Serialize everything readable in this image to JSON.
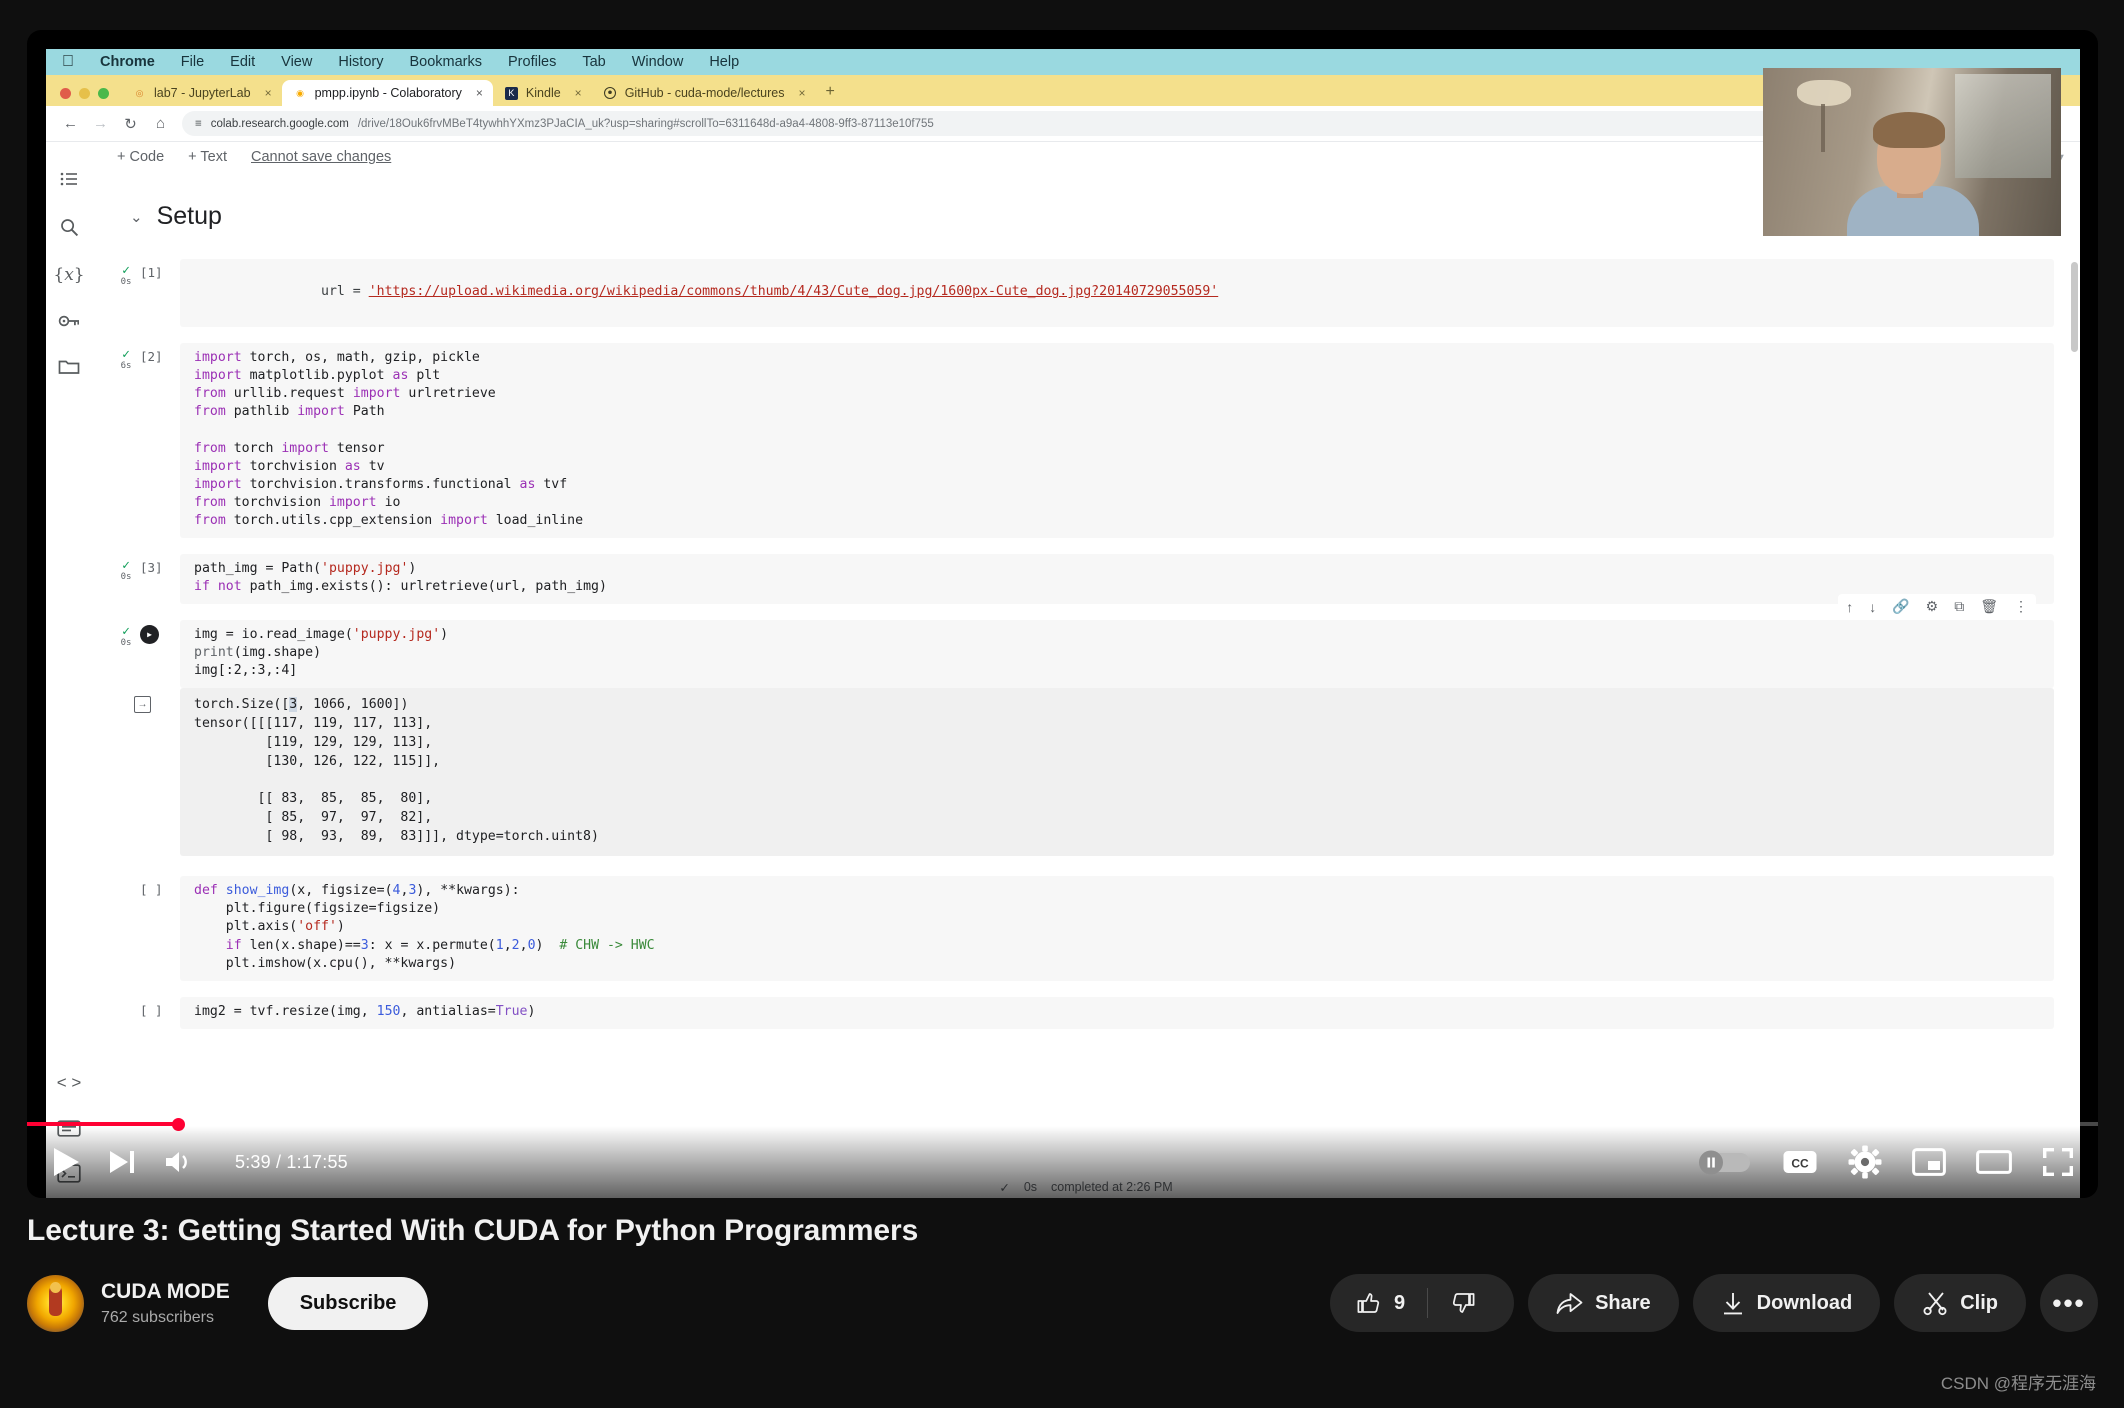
{
  "os_menu": {
    "apple": "apple-logo",
    "items": [
      "Chrome",
      "File",
      "Edit",
      "View",
      "History",
      "Bookmarks",
      "Profiles",
      "Tab",
      "Window",
      "Help"
    ]
  },
  "browser": {
    "tabs": [
      {
        "title": "lab7 - JupyterLab",
        "favicon": "jupyter-icon",
        "active": false
      },
      {
        "title": "pmpp.ipynb - Colaboratory",
        "favicon": "colab-icon",
        "active": true
      },
      {
        "title": "Kindle",
        "favicon": "kindle-icon",
        "active": false
      },
      {
        "title": "GitHub - cuda-mode/lectures",
        "favicon": "github-icon",
        "active": false
      }
    ],
    "new_tab_label": "+",
    "close_label": "×",
    "nav": {
      "back": "←",
      "forward": "→",
      "reload": "↻",
      "home": "⌂"
    },
    "url_prefix": "colab.research.google.com",
    "url_path": "/drive/18Ouk6frvMBeT4tywhhYXmz3PJaCIA_uk?usp=sharing#scrollTo=6311648d-a9a4-4808-9ff3-87113e10f755",
    "omnibox_icons": [
      "zoom-icon",
      "bookmark-star-icon"
    ],
    "toolbar_icons": [
      "reading-list-icon",
      "extensions-icon",
      "profile-icon",
      "share-icon",
      "pin-icon",
      "menu-icon"
    ]
  },
  "colab": {
    "sidebar_icons": [
      "table-of-contents-icon",
      "search-icon",
      "variables-icon",
      "secrets-key-icon",
      "files-folder-icon",
      "code-snippets-icon",
      "terminal-panel-icon",
      "terminal-icon"
    ],
    "toolbar": {
      "add_code": "+ Code",
      "add_text": "+ Text",
      "save_status": "Cannot save changes"
    },
    "section": {
      "caret": "⌄",
      "title": "Setup"
    },
    "cell_tools": [
      "move-cell-up-icon",
      "move-cell-down-icon",
      "link-to-cell-icon",
      "cell-settings-icon",
      "copy-cell-icon",
      "delete-cell-icon",
      "more-cell-actions-icon"
    ],
    "status": {
      "check": "✓",
      "runtime": "0s",
      "text": "completed at 2:26 PM"
    },
    "cells": [
      {
        "exec_count": "[1]",
        "runtime": "0s",
        "state": "done",
        "lines": [
          {
            "segs": [
              {
                "t": "url = ",
                "c": "fn"
              },
              {
                "t": "'https://upload.wikimedia.org/wikipedia/commons/thumb/4/43/Cute_dog.jpg/1600px-Cute_dog.jpg?20140729055059'",
                "c": "strlink"
              }
            ]
          }
        ]
      },
      {
        "exec_count": "[2]",
        "runtime": "6s",
        "state": "done",
        "lines": [
          {
            "segs": [
              {
                "t": "import",
                "c": "kw"
              },
              {
                "t": " torch, os, math, gzip, pickle",
                "c": "fn"
              }
            ]
          },
          {
            "segs": [
              {
                "t": "import",
                "c": "kw"
              },
              {
                "t": " matplotlib.pyplot ",
                "c": "fn"
              },
              {
                "t": "as",
                "c": "kw"
              },
              {
                "t": " plt",
                "c": "fn"
              }
            ]
          },
          {
            "segs": [
              {
                "t": "from",
                "c": "kw"
              },
              {
                "t": " urllib.request ",
                "c": "fn"
              },
              {
                "t": "import",
                "c": "kw"
              },
              {
                "t": " urlretrieve",
                "c": "fn"
              }
            ]
          },
          {
            "segs": [
              {
                "t": "from",
                "c": "kw"
              },
              {
                "t": " pathlib ",
                "c": "fn"
              },
              {
                "t": "import",
                "c": "kw"
              },
              {
                "t": " Path",
                "c": "fn"
              }
            ]
          },
          {
            "segs": [
              {
                "t": "",
                "c": "fn"
              }
            ]
          },
          {
            "segs": [
              {
                "t": "from",
                "c": "kw"
              },
              {
                "t": " torch ",
                "c": "fn"
              },
              {
                "t": "import",
                "c": "kw"
              },
              {
                "t": " tensor",
                "c": "fn"
              }
            ]
          },
          {
            "segs": [
              {
                "t": "import",
                "c": "kw"
              },
              {
                "t": " torchvision ",
                "c": "fn"
              },
              {
                "t": "as",
                "c": "kw"
              },
              {
                "t": " tv",
                "c": "fn"
              }
            ]
          },
          {
            "segs": [
              {
                "t": "import",
                "c": "kw"
              },
              {
                "t": " torchvision.transforms.functional ",
                "c": "fn"
              },
              {
                "t": "as",
                "c": "kw"
              },
              {
                "t": " tvf",
                "c": "fn"
              }
            ]
          },
          {
            "segs": [
              {
                "t": "from",
                "c": "kw"
              },
              {
                "t": " torchvision ",
                "c": "fn"
              },
              {
                "t": "import",
                "c": "kw"
              },
              {
                "t": " io",
                "c": "fn"
              }
            ]
          },
          {
            "segs": [
              {
                "t": "from",
                "c": "kw"
              },
              {
                "t": " torch.utils.cpp_extension ",
                "c": "fn"
              },
              {
                "t": "import",
                "c": "kw"
              },
              {
                "t": " load_inline",
                "c": "fn"
              }
            ]
          }
        ]
      },
      {
        "exec_count": "[3]",
        "runtime": "0s",
        "state": "done",
        "lines": [
          {
            "segs": [
              {
                "t": "path_img = Path(",
                "c": "fn"
              },
              {
                "t": "'puppy.jpg'",
                "c": "str"
              },
              {
                "t": ")",
                "c": "fn"
              }
            ]
          },
          {
            "segs": [
              {
                "t": "if",
                "c": "kw"
              },
              {
                "t": " ",
                "c": "fn"
              },
              {
                "t": "not",
                "c": "kw"
              },
              {
                "t": " path_img.exists(): urlretrieve(url, path_img)",
                "c": "fn"
              }
            ]
          }
        ]
      },
      {
        "exec_count": "",
        "runtime": "0s",
        "state": "hover-run",
        "lines": [
          {
            "segs": [
              {
                "t": "img = io.read_image(",
                "c": "fn"
              },
              {
                "t": "'puppy.jpg'",
                "c": "str"
              },
              {
                "t": ")",
                "c": "fn"
              }
            ]
          },
          {
            "segs": [
              {
                "t": "print",
                "c": "gry"
              },
              {
                "t": "(img.shape)",
                "c": "fn"
              }
            ]
          },
          {
            "segs": [
              {
                "t": "img[:2,:3,:4]",
                "c": "fn"
              }
            ]
          }
        ],
        "output_lines": [
          "torch.Size([3, 1066, 1600])",
          "tensor([[[117, 119, 117, 113],",
          "         [119, 129, 129, 113],",
          "         [130, 126, 122, 115]],",
          "",
          "        [[ 83,  85,  85,  80],",
          "         [ 85,  97,  97,  82],",
          "         [ 98,  93,  89,  83]]], dtype=torch.uint8)"
        ]
      },
      {
        "exec_count": "[ ]",
        "runtime": "",
        "state": "idle",
        "lines": [
          {
            "segs": [
              {
                "t": "def",
                "c": "kw"
              },
              {
                "t": " ",
                "c": "fn"
              },
              {
                "t": "show_img",
                "c": "blu"
              },
              {
                "t": "(x, figsize=(",
                "c": "fn"
              },
              {
                "t": "4",
                "c": "blu"
              },
              {
                "t": ",",
                "c": "fn"
              },
              {
                "t": "3",
                "c": "blu"
              },
              {
                "t": "), **kwargs):",
                "c": "fn"
              }
            ]
          },
          {
            "segs": [
              {
                "t": "    plt.figure(figsize=figsize)",
                "c": "fn"
              }
            ]
          },
          {
            "segs": [
              {
                "t": "    plt.axis(",
                "c": "fn"
              },
              {
                "t": "'off'",
                "c": "str"
              },
              {
                "t": ")",
                "c": "fn"
              }
            ]
          },
          {
            "segs": [
              {
                "t": "    ",
                "c": "fn"
              },
              {
                "t": "if",
                "c": "kw"
              },
              {
                "t": " len(x.shape)==",
                "c": "fn"
              },
              {
                "t": "3",
                "c": "blu"
              },
              {
                "t": ": x = x.permute(",
                "c": "fn"
              },
              {
                "t": "1",
                "c": "blu"
              },
              {
                "t": ",",
                "c": "fn"
              },
              {
                "t": "2",
                "c": "blu"
              },
              {
                "t": ",",
                "c": "fn"
              },
              {
                "t": "0",
                "c": "blu"
              },
              {
                "t": ")  ",
                "c": "fn"
              },
              {
                "t": "# CHW -> HWC",
                "c": "cmt"
              }
            ]
          },
          {
            "segs": [
              {
                "t": "    plt.imshow(x.cpu(), **kwargs)",
                "c": "fn"
              }
            ]
          }
        ]
      },
      {
        "exec_count": "[ ]",
        "runtime": "",
        "state": "idle",
        "lines": [
          {
            "segs": [
              {
                "t": "img2 = tvf.resize(img, ",
                "c": "fn"
              },
              {
                "t": "150",
                "c": "blu"
              },
              {
                "t": ", antialias=",
                "c": "fn"
              },
              {
                "t": "True",
                "c": "kw2"
              },
              {
                "t": ")",
                "c": "fn"
              }
            ]
          }
        ]
      }
    ]
  },
  "player": {
    "play_icon": "play-icon",
    "next_icon": "next-video-icon",
    "volume_icon": "volume-icon",
    "time": "5:39 / 1:17:55",
    "current_time": "5:39",
    "duration": "1:17:55",
    "progress_percent": 7.3,
    "right_controls": [
      {
        "name": "autoplay-toggle",
        "label": "autoplay"
      },
      {
        "name": "subtitles-cc-button",
        "label": "CC"
      },
      {
        "name": "settings-gear-button",
        "label": "settings"
      },
      {
        "name": "miniplayer-button",
        "label": "miniplayer"
      },
      {
        "name": "theater-mode-button",
        "label": "theater"
      },
      {
        "name": "fullscreen-button",
        "label": "fullscreen"
      }
    ]
  },
  "video": {
    "title": "Lecture 3: Getting Started With CUDA for Python Programmers",
    "channel": {
      "name": "CUDA MODE",
      "subscribers": "762 subscribers",
      "avatar": "cuda-mode-avatar"
    },
    "subscribe_label": "Subscribe",
    "actions": {
      "like_count": "9",
      "like_icon": "thumbs-up-icon",
      "dislike_icon": "thumbs-down-icon",
      "share_label": "Share",
      "share_icon": "share-arrow-icon",
      "download_label": "Download",
      "download_icon": "download-arrow-icon",
      "clip_label": "Clip",
      "clip_icon": "scissors-icon",
      "more_label": "•••"
    }
  },
  "watermark": "CSDN @程序无涯海",
  "colors": {
    "progress_red": "#ff0033",
    "menu_bar": "#9ad9e0",
    "tab_strip": "#f4e08c",
    "page_bg": "#0f0f0f",
    "pill_bg": "#272727"
  }
}
